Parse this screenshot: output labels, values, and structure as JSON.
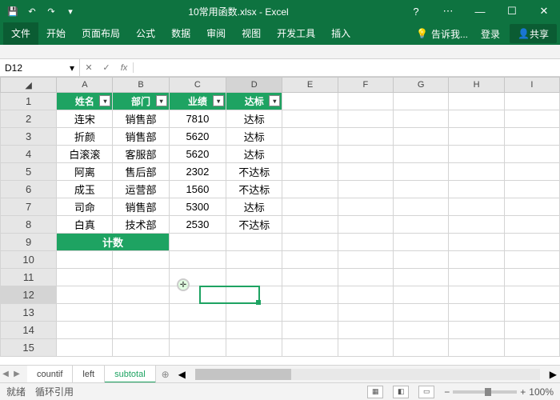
{
  "title": "10常用函数.xlsx - Excel",
  "qat": {
    "save": "💾",
    "undo": "↶",
    "redo": "↷",
    "more": "▾"
  },
  "win": {
    "help": "?",
    "opts": "⋯",
    "min": "—",
    "max": "☐",
    "close": "✕"
  },
  "ribbon": {
    "file": "文件",
    "tabs": [
      "开始",
      "页面布局",
      "公式",
      "数据",
      "审阅",
      "视图",
      "开发工具",
      "插入"
    ],
    "tell": "告诉我...",
    "login": "登录",
    "share": "共享"
  },
  "namebox": "D12",
  "fx": "fx",
  "cols": [
    "A",
    "B",
    "C",
    "D",
    "E",
    "F",
    "G",
    "H",
    "I"
  ],
  "headers": [
    {
      "label": "姓名"
    },
    {
      "label": "部门"
    },
    {
      "label": "业绩"
    },
    {
      "label": "达标"
    }
  ],
  "rows": [
    {
      "n": "连宋",
      "d": "销售部",
      "p": "7810",
      "s": "达标"
    },
    {
      "n": "折颜",
      "d": "销售部",
      "p": "5620",
      "s": "达标"
    },
    {
      "n": "白滚滚",
      "d": "客服部",
      "p": "5620",
      "s": "达标"
    },
    {
      "n": "阿离",
      "d": "售后部",
      "p": "2302",
      "s": "不达标"
    },
    {
      "n": "成玉",
      "d": "运营部",
      "p": "1560",
      "s": "不达标"
    },
    {
      "n": "司命",
      "d": "销售部",
      "p": "5300",
      "s": "达标"
    },
    {
      "n": "白真",
      "d": "技术部",
      "p": "2530",
      "s": "不达标"
    }
  ],
  "countLabel": "计数",
  "sheets": {
    "nav": [
      "◀",
      "▶"
    ],
    "tabs": [
      "countif",
      "left",
      "subtotal"
    ],
    "add": "⊕"
  },
  "status": {
    "ready": "就绪",
    "circ": "循环引用",
    "scroll": "◀ ▶",
    "views": [
      "▦",
      "◧",
      "▭"
    ],
    "zoomminus": "−",
    "zoomplus": "+",
    "zoom": "100%"
  }
}
